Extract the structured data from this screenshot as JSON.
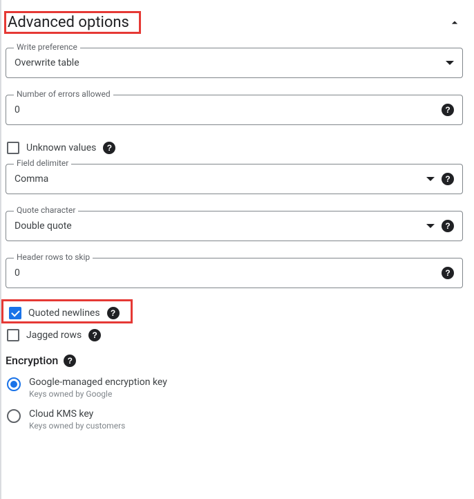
{
  "section": {
    "title": "Advanced options"
  },
  "writePref": {
    "label": "Write preference",
    "value": "Overwrite table"
  },
  "errorsAllowed": {
    "label": "Number of errors allowed",
    "value": "0"
  },
  "unknownValues": {
    "label": "Unknown values",
    "checked": false
  },
  "fieldDelimiter": {
    "label": "Field delimiter",
    "value": "Comma"
  },
  "quoteChar": {
    "label": "Quote character",
    "value": "Double quote"
  },
  "headerSkip": {
    "label": "Header rows to skip",
    "value": "0"
  },
  "quotedNewlines": {
    "label": "Quoted newlines",
    "checked": true
  },
  "jaggedRows": {
    "label": "Jagged rows",
    "checked": false
  },
  "encryption": {
    "title": "Encryption",
    "options": [
      {
        "label": "Google-managed encryption key",
        "sublabel": "Keys owned by Google",
        "selected": true
      },
      {
        "label": "Cloud KMS key",
        "sublabel": "Keys owned by customers",
        "selected": false
      }
    ]
  }
}
